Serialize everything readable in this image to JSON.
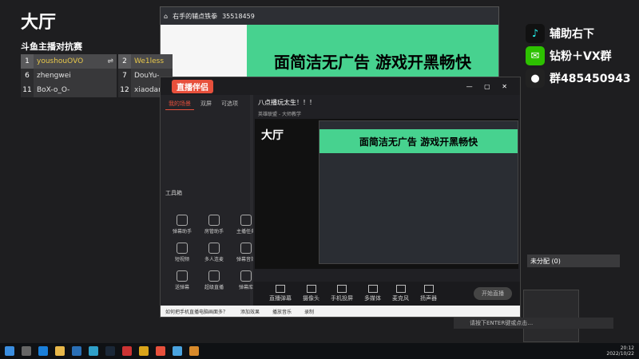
{
  "lobby": {
    "title": "大厅",
    "subtitle": "斗鱼主播对抗赛",
    "rows": [
      {
        "num": "1",
        "name": "youshouOVO",
        "swap": "⇌",
        "num2": "2",
        "name2": "We1less"
      },
      {
        "num": "6",
        "name": "zhengwei",
        "num2": "7",
        "name2": "DouYu-"
      },
      {
        "num": "11",
        "name": "BoX-o_O-",
        "num2": "12",
        "name2": "xiaodan"
      }
    ]
  },
  "social": {
    "douyin": "辅助右下",
    "wechat": "钻粉＋VX群",
    "qq": "群485450943"
  },
  "browser": {
    "tab_title": "右手的辅点铁拳",
    "room_id": "35518459",
    "banner": "面简洁无广告  游戏开黑畅快"
  },
  "app": {
    "logo": "直播伴侣",
    "tabs": [
      "我的场景",
      "双屏",
      "可选项"
    ],
    "room_title": "八点播玩太生！！！",
    "room_info": "英雄联盟 - 大师教学",
    "preview_title": "大厅",
    "preview_banner": "面简洁无广告  游戏开黑畅快",
    "tools_header": "工具箱",
    "tools": [
      "弹幕助手",
      "房管助手",
      "主播任务",
      "短视频",
      "多人连麦",
      "弹幕音效",
      "送弹幕",
      "超级直播",
      "弹幕库"
    ],
    "bottom_buttons": [
      "直播弹幕",
      "摄像头",
      "手机投屏",
      "多媒体",
      "麦克风",
      "扬声器"
    ],
    "start_live": "开始直播",
    "status": [
      "如何把手机直播电脑画面多？",
      "添加效果",
      "播放音乐",
      "录制"
    ]
  },
  "unassigned": "未分配 (0)",
  "chat_hint": "请按下ENTER键或点击…",
  "clock": {
    "time": "20:12",
    "date": "2022/10/22"
  }
}
